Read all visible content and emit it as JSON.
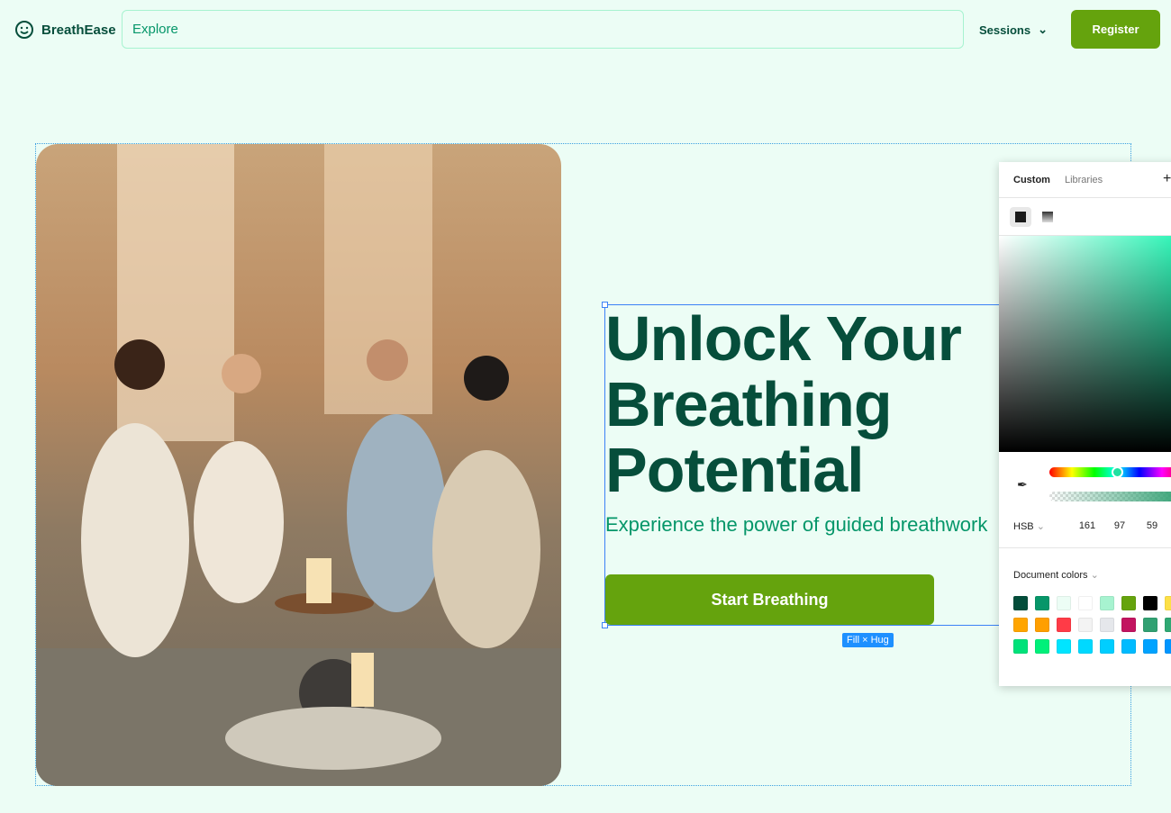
{
  "header": {
    "brand": "BreathEase",
    "search_value": "Explore",
    "sessions_label": "Sessions",
    "register_label": "Register",
    "logo_icon": "smiley-icon"
  },
  "hero": {
    "title_lines": [
      "Unlock Your",
      "Breathing",
      "Potential"
    ],
    "subtitle": "Experience the power of guided breathwork",
    "cta_label": "Start Breathing",
    "size_badge": "Fill × Hug"
  },
  "colors": {
    "accent": "#65a30d",
    "heading": "#064e3b",
    "subtitle": "#059669",
    "background": "#ecfdf5"
  },
  "color_picker": {
    "tabs": [
      "Custom",
      "Libraries"
    ],
    "mode": "HSB",
    "values": [
      "161",
      "97",
      "59"
    ],
    "document_colors_label": "Document colors",
    "swatches": [
      "#034d3a",
      "#079669",
      "#ecfdf5",
      "#ffffff",
      "#a7f3d0",
      "#65a30d",
      "#000000",
      "#fde047",
      "#ffa500",
      "#ff9f00",
      "#ff3b47",
      "#f3f3f3",
      "#e5e7eb",
      "#c21460",
      "#31a072",
      "#2fa873",
      "#00e27a",
      "#00f07a",
      "#00e5ff",
      "#00d9ff",
      "#00ceff",
      "#00bbff",
      "#00a3ff",
      "#0096ff"
    ]
  }
}
